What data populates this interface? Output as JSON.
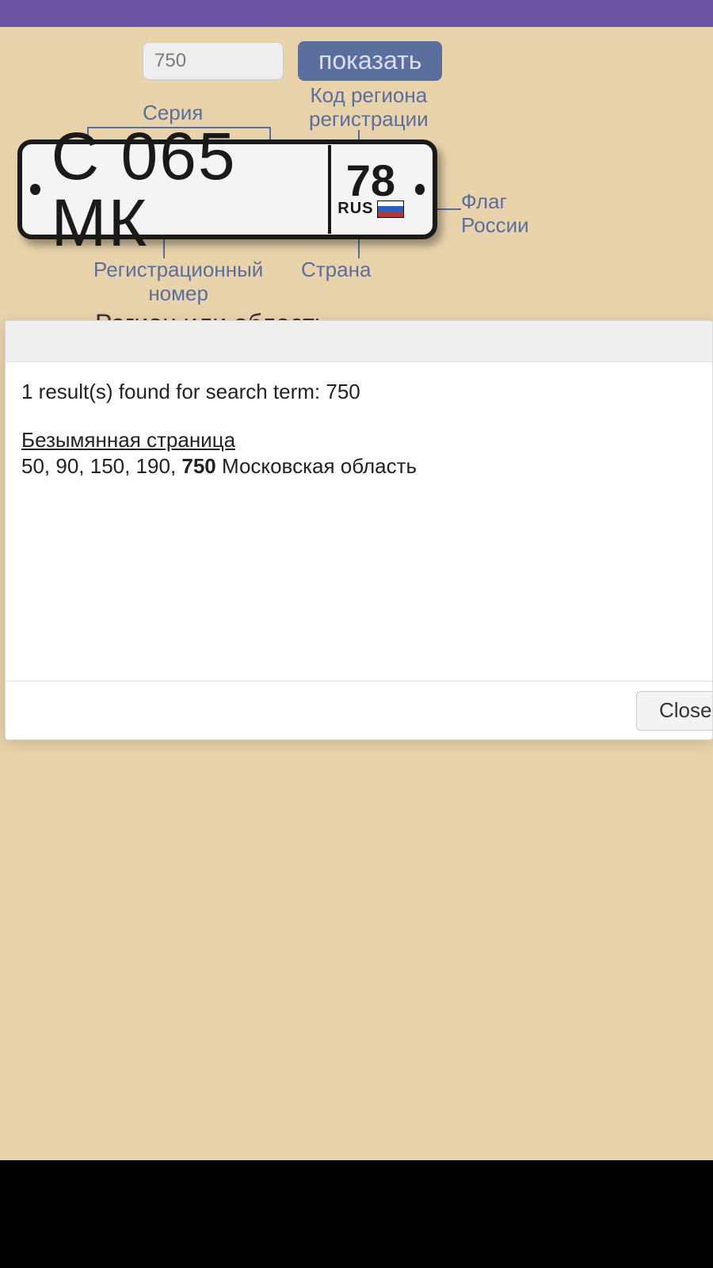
{
  "search": {
    "value": "750",
    "button_label": "показать"
  },
  "diagram": {
    "series_label": "Серия",
    "region_code_label": "Код региона\nрегистрации",
    "flag_label": "Флаг\nРоссии",
    "country_label": "Страна",
    "reg_number_label": "Регистрационный\nномер",
    "plate": {
      "main": "С 065 МК",
      "region_code": "78",
      "rus": "RUS"
    }
  },
  "section_title": "Регион или область",
  "results": {
    "count_prefix": "1 result(s) found for search term: ",
    "term": "750",
    "link_title": "Безымянная страница",
    "line_prefix": "50, 90, 150, 190, ",
    "line_bold": "750",
    "line_suffix": " Московская область",
    "close_label": "Close"
  }
}
